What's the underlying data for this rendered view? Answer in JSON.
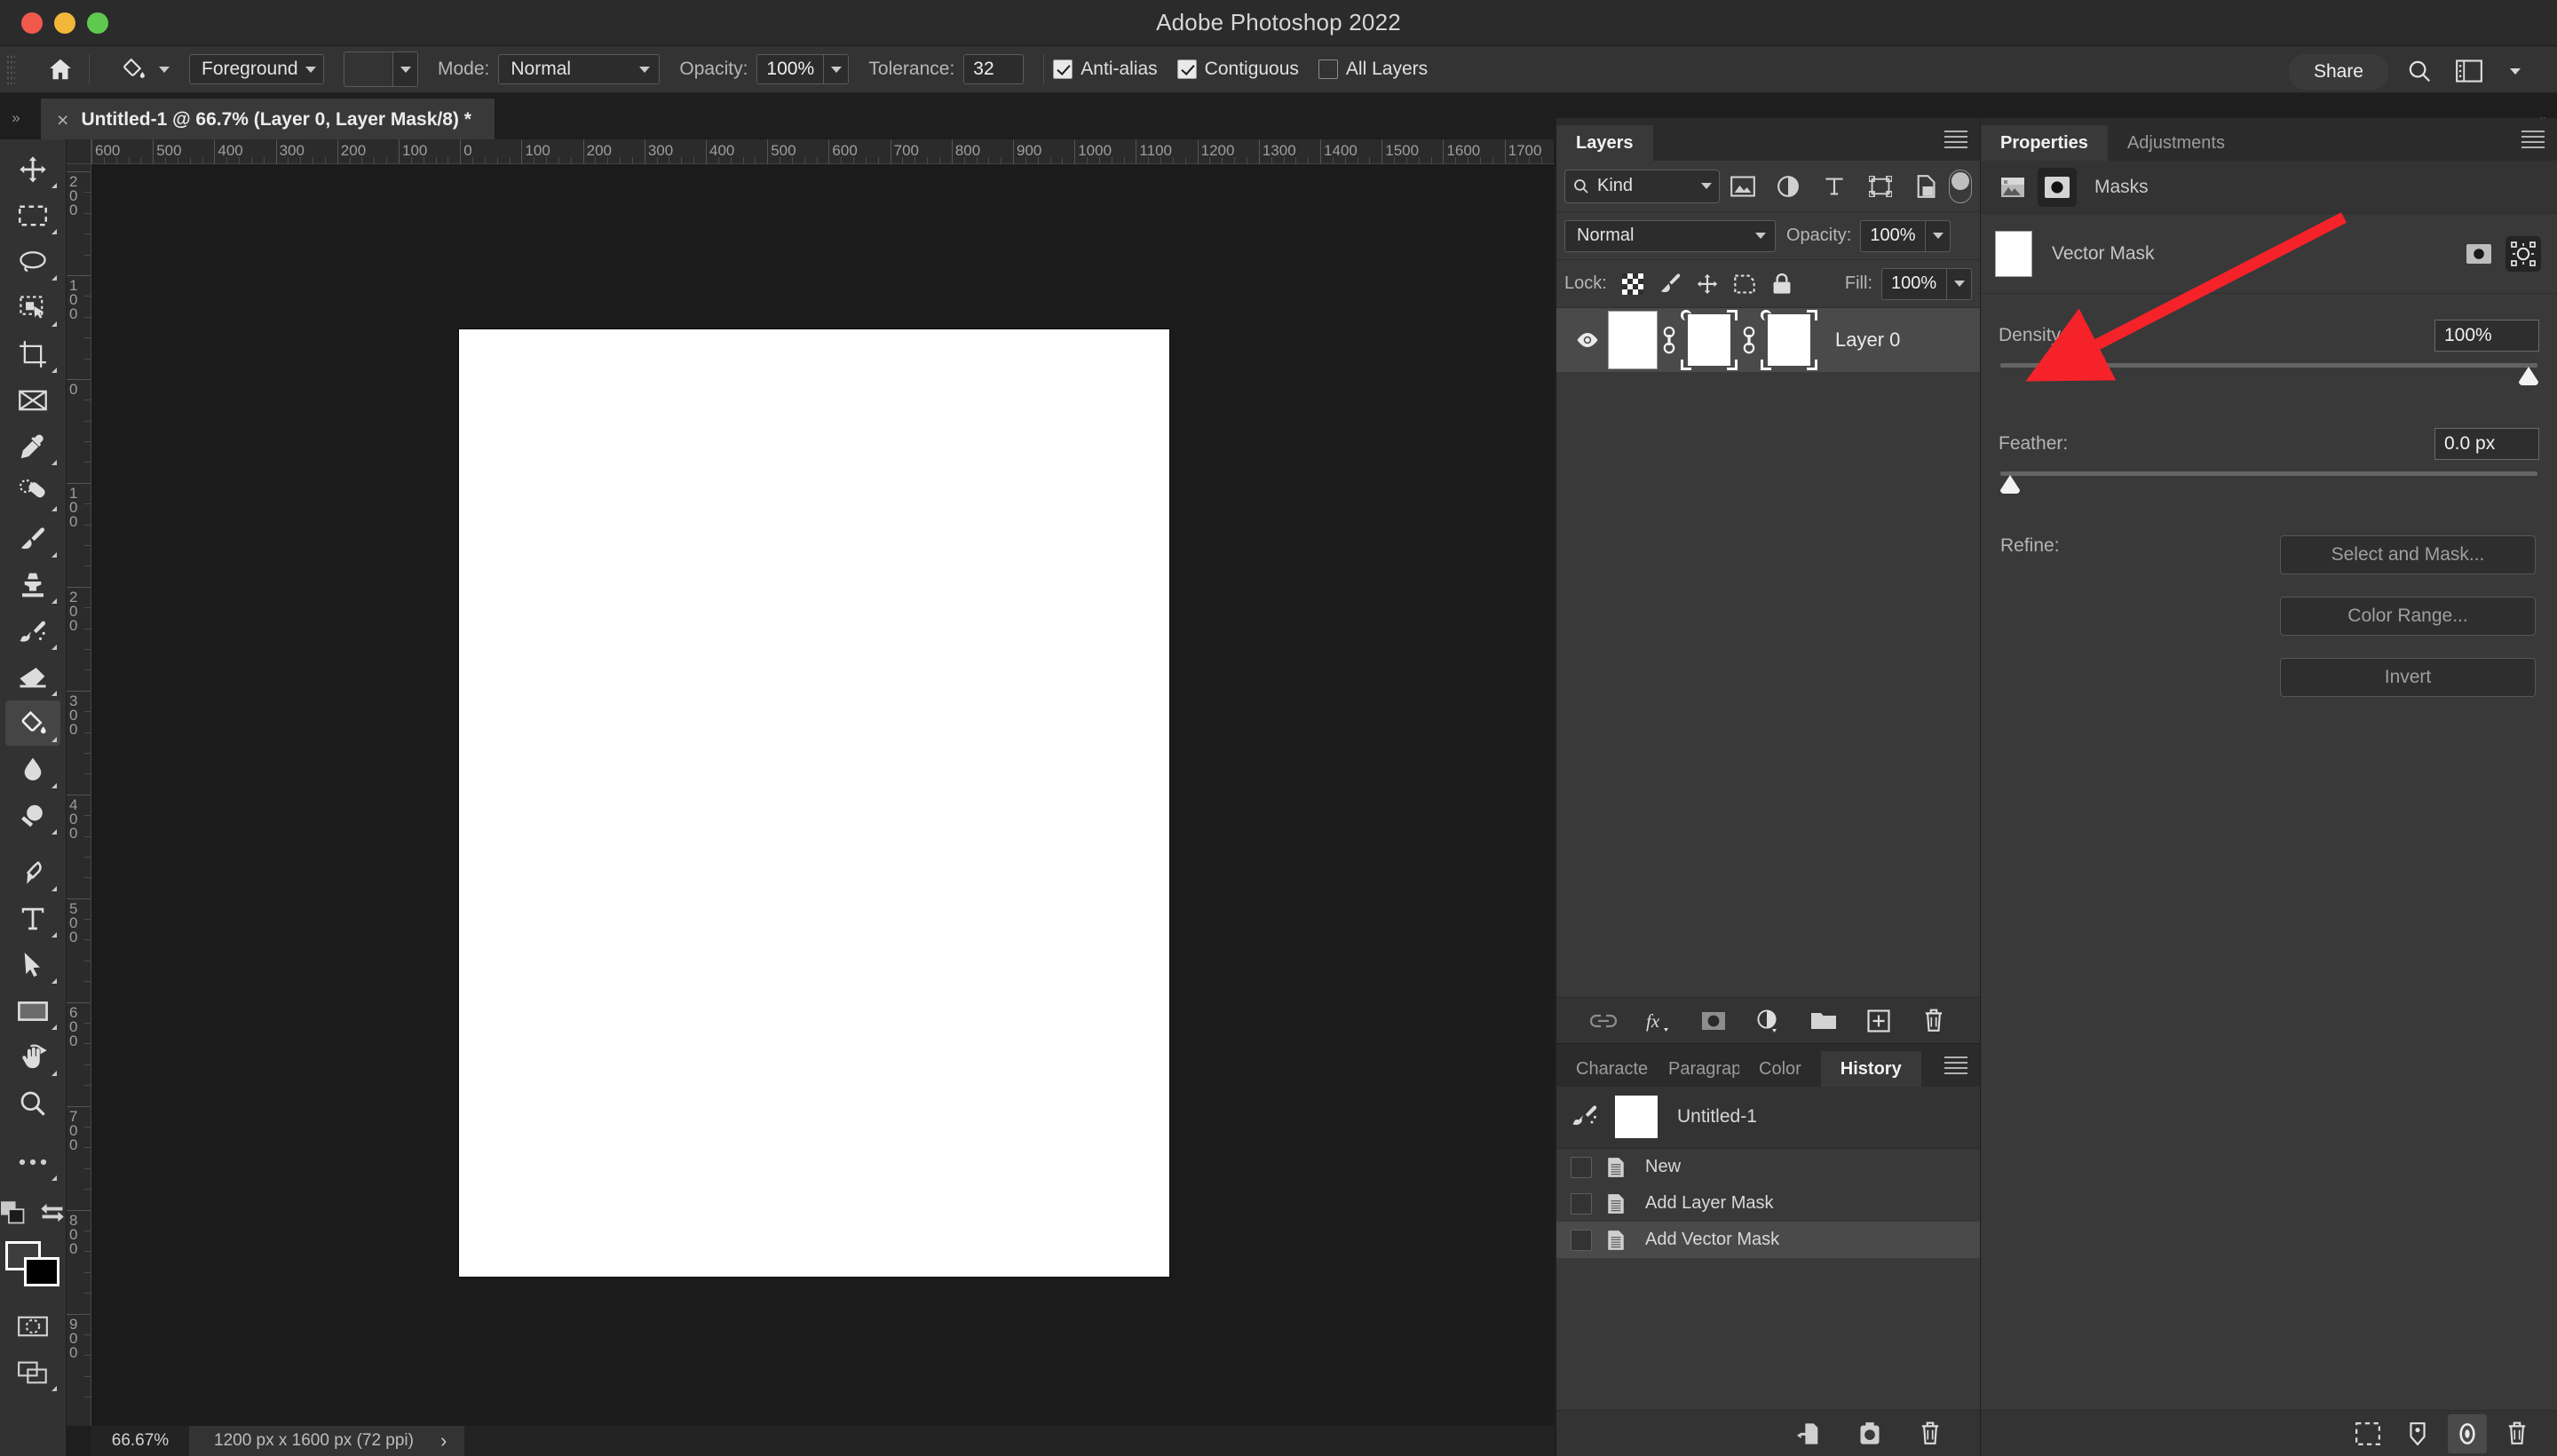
{
  "app": {
    "title": "Adobe Photoshop 2022"
  },
  "window_controls": {
    "close": "close",
    "minimize": "minimize",
    "maximize": "maximize"
  },
  "options_bar": {
    "home_icon": "home-icon",
    "tool_icon": "paint-bucket-icon",
    "fill_source": "Foreground",
    "pattern_swatch": "",
    "mode_label": "Mode:",
    "mode_value": "Normal",
    "opacity_label": "Opacity:",
    "opacity_value": "100%",
    "tolerance_label": "Tolerance:",
    "tolerance_value": "32",
    "antialias_label": "Anti-alias",
    "antialias_checked": true,
    "contiguous_label": "Contiguous",
    "contiguous_checked": true,
    "alllayers_label": "All Layers",
    "alllayers_checked": false,
    "share_label": "Share",
    "search_icon": "search-icon",
    "workspace_icon": "workspace-icon",
    "chevron_icon": "chevron-down-icon"
  },
  "document_tab": {
    "close_icon": "close-icon",
    "title": "Untitled-1 @ 66.7% (Layer 0, Layer Mask/8) *",
    "overflow_left": "»",
    "overflow_right": "»"
  },
  "toolbar": {
    "tools": [
      {
        "name": "move-tool",
        "glyph": "move"
      },
      {
        "name": "rectangular-marquee-tool",
        "glyph": "marquee"
      },
      {
        "name": "lasso-tool",
        "glyph": "lasso"
      },
      {
        "name": "object-selection-tool",
        "glyph": "objsel"
      },
      {
        "name": "crop-tool",
        "glyph": "crop"
      },
      {
        "name": "frame-tool",
        "glyph": "frame"
      },
      {
        "name": "eyedropper-tool",
        "glyph": "eyedropper"
      },
      {
        "name": "healing-brush-tool",
        "glyph": "heal"
      },
      {
        "name": "brush-tool",
        "glyph": "brush"
      },
      {
        "name": "clone-stamp-tool",
        "glyph": "stamp"
      },
      {
        "name": "history-brush-tool",
        "glyph": "histbrush"
      },
      {
        "name": "eraser-tool",
        "glyph": "eraser"
      },
      {
        "name": "gradient-paint-bucket-tool",
        "glyph": "bucket",
        "active": true
      },
      {
        "name": "blur-tool",
        "glyph": "blur"
      },
      {
        "name": "dodge-tool",
        "glyph": "dodge"
      },
      {
        "name": "pen-tool",
        "glyph": "pen"
      },
      {
        "name": "type-tool",
        "glyph": "type"
      },
      {
        "name": "path-selection-tool",
        "glyph": "arrow"
      },
      {
        "name": "rectangle-tool",
        "glyph": "rect"
      },
      {
        "name": "hand-rotate-tool",
        "glyph": "hand"
      },
      {
        "name": "zoom-tool",
        "glyph": "zoom"
      },
      {
        "name": "edit-toolbar-tool",
        "glyph": "dots"
      }
    ],
    "quickmask_icon": "quick-mask-icon",
    "screenmode_icon": "screen-mode-icon",
    "swap_colors_icon": "swap-colors-icon",
    "default_colors_icon": "default-colors-icon"
  },
  "rulers": {
    "horizontal": [
      "600",
      "500",
      "400",
      "300",
      "200",
      "100",
      "0",
      "100",
      "200",
      "300",
      "400",
      "500",
      "600",
      "700",
      "800",
      "900",
      "1000",
      "1100",
      "1200",
      "1300",
      "1400",
      "1500",
      "1600",
      "1700"
    ],
    "vertical": [
      "200",
      "100",
      "0",
      "100",
      "200",
      "300",
      "400",
      "500",
      "600",
      "700",
      "800",
      "900"
    ],
    "unit": "px"
  },
  "status_bar": {
    "zoom": "66.67%",
    "doc_size": "1200 px x 1600 px (72 ppi)",
    "chevron": "›"
  },
  "layers_panel": {
    "tabs": [
      {
        "label": "Layers",
        "active": true
      }
    ],
    "menu_icon": "panel-menu-icon",
    "filter": {
      "kind_label": "Kind",
      "search_icon": "search-icon",
      "chevron_icon": "chevron-down-icon",
      "icons": [
        "pixel-layer-filter-icon",
        "adjustment-layer-filter-icon",
        "type-layer-filter-icon",
        "shape-layer-filter-icon",
        "smart-object-filter-icon"
      ],
      "toggle_icon": "filter-toggle-switch"
    },
    "blend_mode": "Normal",
    "opacity_label": "Opacity:",
    "opacity_value": "100%",
    "lock_label": "Lock:",
    "lock_icons": [
      "lock-transparent-pixels-icon",
      "lock-image-pixels-icon",
      "lock-position-icon",
      "lock-artboard-nesting-icon",
      "lock-all-icon"
    ],
    "fill_label": "Fill:",
    "fill_value": "100%",
    "layers": [
      {
        "name": "Layer 0",
        "visible": true,
        "selected": true,
        "eye_icon": "eye-icon",
        "thumbnail": "layer-thumbnail",
        "link_icon": "link-icon",
        "layer_mask": "layer-mask-thumbnail",
        "vector_mask": "vector-mask-thumbnail"
      }
    ],
    "bottom_icons": [
      "link-layers-icon",
      "add-layer-style-fx-icon",
      "add-layer-mask-icon",
      "new-fill-adjustment-layer-icon",
      "new-group-icon",
      "new-layer-icon",
      "delete-layer-icon"
    ]
  },
  "history_panel": {
    "tabs": [
      {
        "label": "Character",
        "active": false
      },
      {
        "label": "Paragraph",
        "active": false
      },
      {
        "label": "Color",
        "active": false
      },
      {
        "label": "History",
        "active": true
      }
    ],
    "menu_icon": "panel-menu-icon",
    "snapshot": {
      "label": "Untitled-1",
      "icon": "history-brush-source-icon",
      "thumbnail": "snapshot-thumbnail"
    },
    "states": [
      {
        "label": "New",
        "icon": "history-state-icon",
        "selected": false
      },
      {
        "label": "Add Layer Mask",
        "icon": "history-state-icon",
        "selected": false
      },
      {
        "label": "Add Vector Mask",
        "icon": "history-state-icon",
        "selected": true
      }
    ],
    "bottom_icons": [
      "create-document-from-state-icon",
      "create-snapshot-icon",
      "delete-state-icon"
    ]
  },
  "properties_panel": {
    "tabs": [
      {
        "label": "Properties",
        "active": true
      },
      {
        "label": "Adjustments",
        "active": false
      }
    ],
    "menu_icon": "panel-menu-icon",
    "masks_header": {
      "label": "Masks",
      "pixel_mask_icon": "pixel-mask-icon",
      "vector_mask_icon": "vector-mask-icon",
      "selected": "vector-mask-icon"
    },
    "vector_mask": {
      "label": "Vector Mask",
      "thumbnail": "vector-mask-thumbnail",
      "pixel_mask_btn": "select-pixel-mask-icon",
      "vector_mask_btn": "select-vector-mask-icon"
    },
    "density": {
      "label": "Density:",
      "value": "100%",
      "percent": 100
    },
    "feather": {
      "label": "Feather:",
      "value": "0.0 px",
      "percent": 0
    },
    "refine": {
      "label": "Refine:",
      "select_and_mask": "Select and Mask...",
      "color_range": "Color Range...",
      "invert": "Invert"
    },
    "bottom_icons": [
      "load-selection-from-mask-icon",
      "apply-mask-icon",
      "toggle-mask-icon",
      "delete-mask-icon"
    ]
  },
  "annotation": {
    "arrow_color": "#f5222a",
    "shape": "red-arrow-pointing-to-density"
  }
}
